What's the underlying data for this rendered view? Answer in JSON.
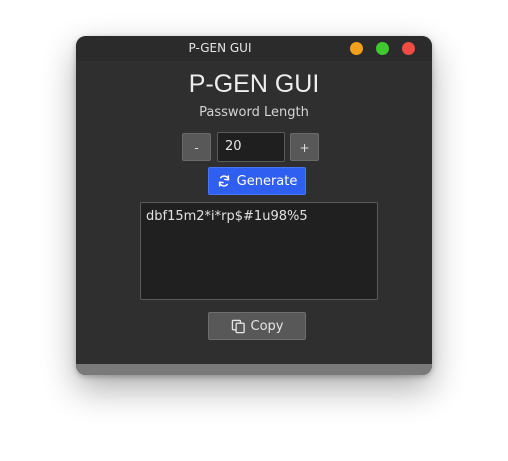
{
  "window": {
    "title": "P-GEN GUI",
    "controls": {
      "minimize_color": "#f2a11c",
      "maximize_color": "#3ec92f",
      "close_color": "#ee4d44"
    }
  },
  "app": {
    "heading": "P-GEN GUI",
    "length_label": "Password Length",
    "length_value": "20",
    "decrement_label": "-",
    "increment_label": "+",
    "generate": {
      "label": "Generate",
      "icon": "refresh-icon",
      "color": "#2f5ff0"
    },
    "password_output": "dbf15m2*i*rp$#1u98%5",
    "copy": {
      "label": "Copy",
      "icon": "copy-icon"
    }
  }
}
